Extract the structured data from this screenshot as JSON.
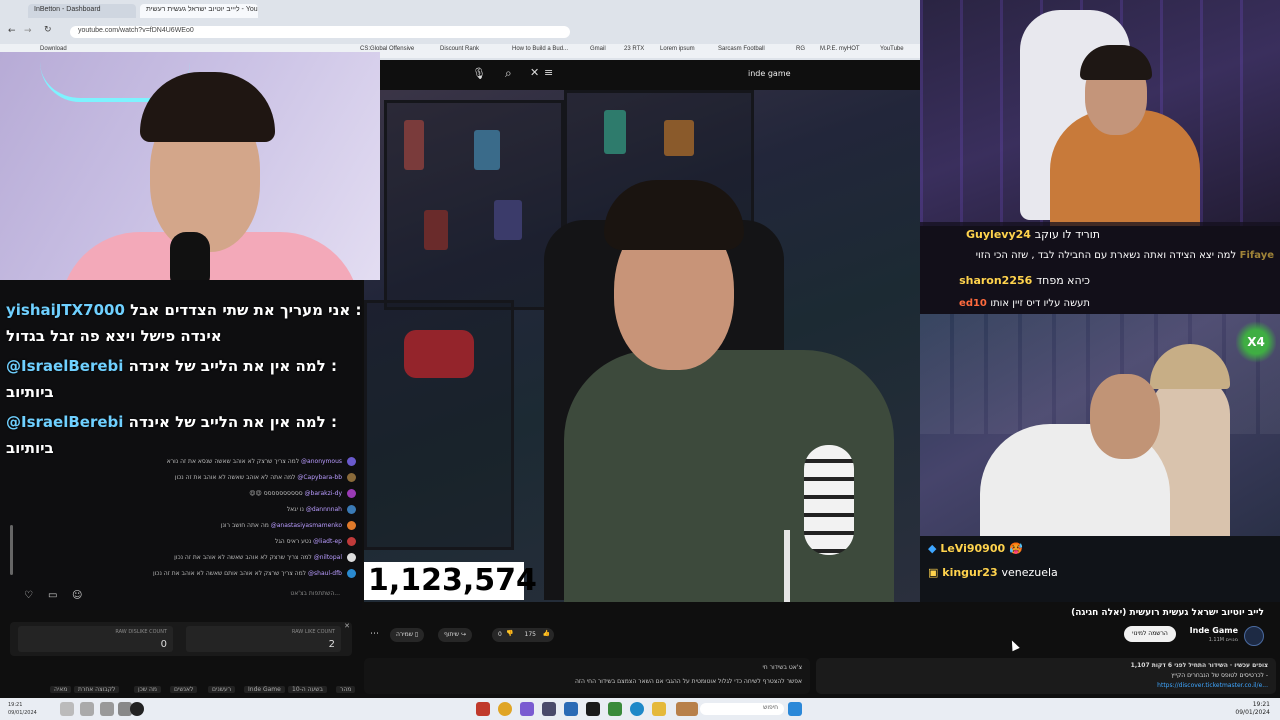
{
  "browser": {
    "tabs": [
      {
        "label": "InBetton - Dashboard"
      },
      {
        "label": "ליייב יוטיוב ישראל געשית רעשית - YouTube"
      }
    ],
    "address": "youtube.com/watch?v=fDN4U6WEo0",
    "bookmarks": [
      "Download",
      "CS:Global Offensive",
      "Discount Rank",
      "How to Build a Bud...",
      "Gmail",
      "23 RTX",
      "Lorem ipsum",
      "Sarcasm Football",
      "RG",
      "M.P.E. myHOT",
      "YouTube"
    ]
  },
  "yt_topbar": {
    "search_query": "inde game"
  },
  "video": {
    "counter": "1,123,574"
  },
  "chat_left": {
    "big_messages": [
      {
        "user": "yishaiJTX7000",
        "text": "אני מעריך את שתי הצדדים אבל :"
      },
      {
        "user": "",
        "text": "אינדה פישל ויצא פה זבל בגדול"
      },
      {
        "user": "@IsraelBerebi",
        "text": "למה אין את הלייב של אינדה :"
      },
      {
        "user": "",
        "text": "ביותיוב"
      },
      {
        "user": "@IsraelBerebi",
        "text": "למה אין את הלייב של אינדה :"
      },
      {
        "user": "",
        "text": "ביותיוב"
      }
    ],
    "small_messages": [
      {
        "user": "@anonymous",
        "text": "למה צריך שרצק לא אוהב שאשה שנסא את זה נורא"
      },
      {
        "user": "@Capybara-bb",
        "text": "למה אתה לא אוהב שאשה לא אוהב את זה נכון"
      },
      {
        "user": "@barakzi-dy",
        "text": "😍😍 סססססססססס"
      },
      {
        "user": "@dannnnah",
        "text": "נו יגאל"
      },
      {
        "user": "@anastasiyasmamenko",
        "text": "מה אתה חושב רונן"
      },
      {
        "user": "@liadt-ep",
        "text": "נטע ראיס הגל"
      },
      {
        "user": "@niltopal",
        "text": "למה צריך שרצק לא אוהב שאשה לא אוהב את זה נכון"
      },
      {
        "user": "@shaul-dfb",
        "text": "למה צריך שרצק לא אוהב אותם שאשה לא אוהב את זה נכון"
      }
    ],
    "input_placeholder": "השתתפות בצ'אט...",
    "counts": {
      "left_label": "RAW DISLIKE COUNT",
      "left_value": "0",
      "right_label": "RAW LIKE COUNT",
      "right_value": "2"
    },
    "shortcuts": [
      "מאיה",
      "לקבוצה אחרת",
      "מה שכן",
      "לאנשים",
      "רעשנים",
      "Inde Game",
      "בשעה ה-10",
      "מהר"
    ]
  },
  "chat_right_top": [
    {
      "user": "Guylevy24",
      "text": "תוריד לו עוקב"
    },
    {
      "user": "Fifaye",
      "text": "למה יצא הצידה ואתה נשארת עם החבילה לבד , שזה הכי הזוי"
    },
    {
      "user": "sharon2256",
      "text": "כיהא מפחד"
    },
    {
      "user": "ed10",
      "text": "תעשה עליו דיס זיין אותו"
    }
  ],
  "chat_right_bottom": [
    {
      "user": "LeVi90900",
      "text": "🥵"
    },
    {
      "user": "kingur23",
      "text": "venezuela"
    }
  ],
  "x4_badge": "X4",
  "yt_info": {
    "title": "לייב יוטיוב ישראל געשית רועשית (יאלה חגיגה)",
    "channel_name": "Inde Game",
    "channel_subs": "1.11M מנויים",
    "subscribe_label": "הרשמה למינוי",
    "like_count": "175",
    "dislike_count": "0",
    "share_label": "שיתוף",
    "save_label": "שמירה",
    "desc_stats": "1,107 צופים עכשיו · השידור התחיל לפני 6 דקות",
    "desc_line2": "לכרטיסים לטופס של הנבחרים הקייץ -",
    "desc_link": "https://discover.ticketmaster.co.il/e...",
    "comment_line1": "צ'אט בשידור חי",
    "comment_line2": "אפשר להצטרף לשיחה כדי לגלול אוטומטית על ההגבי אם השאר הצמצם בשידור החי הזה"
  },
  "taskbar": {
    "search_placeholder": "חיפוש",
    "time": "19:21",
    "date": "09/01/2024",
    "left_time": "19:21",
    "left_date": "09/01/2024"
  },
  "colors": {
    "chat_user_blue": "#6fd0ff",
    "chat_user_yellow": "#ffd34d",
    "link_blue": "#3ea6ff"
  }
}
